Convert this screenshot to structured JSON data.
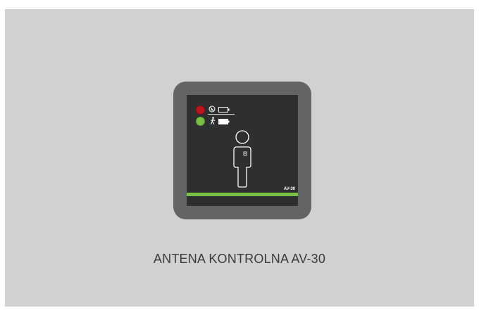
{
  "device": {
    "model_label": "AV-30",
    "indicators": [
      {
        "name": "alarm",
        "color": "#c0141c",
        "icons": [
          "no-tag-icon",
          "battery-empty-icon"
        ]
      },
      {
        "name": "ok",
        "color": "#78c145",
        "icons": [
          "walking-person-icon",
          "battery-full-icon"
        ]
      }
    ],
    "accent_color": "#7ac143"
  },
  "caption": "ANTENA KONTROLNA AV-30"
}
